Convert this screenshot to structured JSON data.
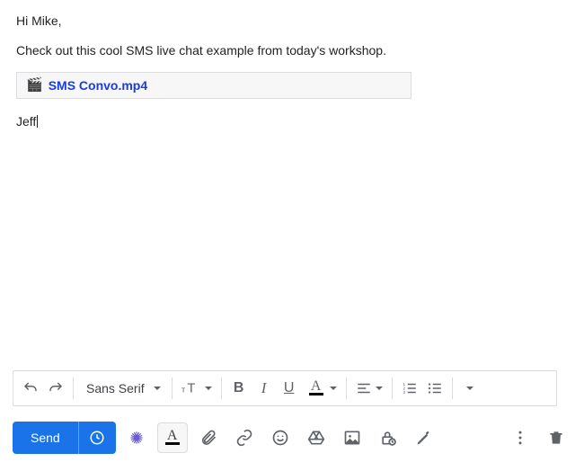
{
  "body": {
    "greeting": "Hi Mike,",
    "paragraph": "Check out this cool SMS live chat example from today's workshop.",
    "signature": "Jeff"
  },
  "attachment": {
    "icon": "🎬",
    "name": "SMS Convo.mp4"
  },
  "format_toolbar": {
    "font_family": "Sans Serif",
    "bold_glyph": "B",
    "italic_glyph": "I",
    "underline_glyph": "U",
    "text_color_glyph": "A",
    "font_size_glyph": "тT",
    "text_color_bar": "#000000"
  },
  "actions": {
    "send_label": "Send",
    "text_format_glyph": "A",
    "text_format_bar": "#000000"
  },
  "colors": {
    "primary": "#1a73e8",
    "link": "#1a3be8",
    "danger": "#d93025"
  }
}
